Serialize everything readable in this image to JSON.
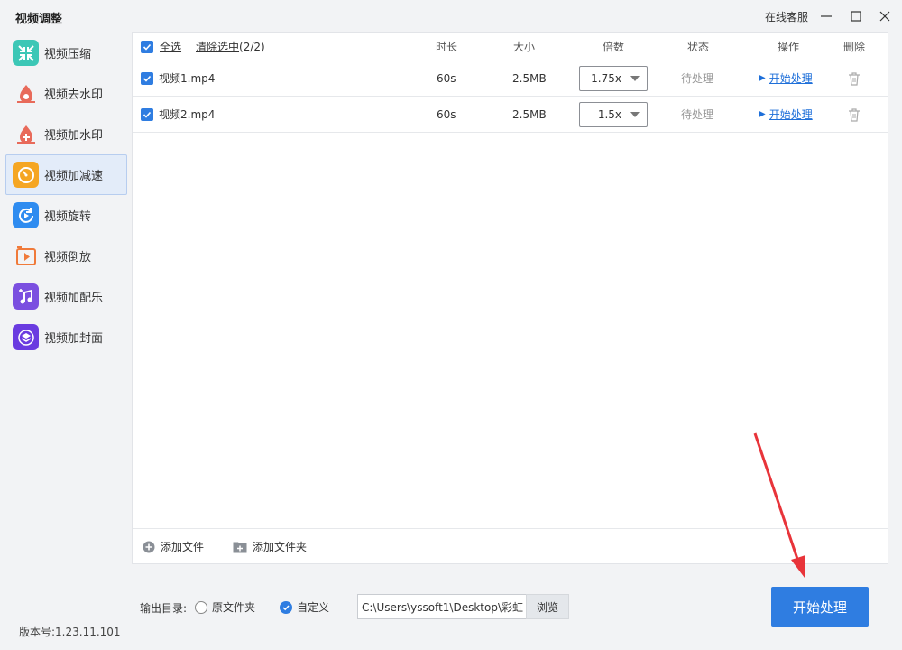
{
  "app": {
    "title": "视频调整",
    "service_label": "在线客服"
  },
  "sidebar": {
    "items": [
      {
        "label": "视频压缩",
        "icon": "compress-icon",
        "color": "#3cc7b6"
      },
      {
        "label": "视频去水印",
        "icon": "watermark-remove-icon",
        "color": "#e86a5a"
      },
      {
        "label": "视频加水印",
        "icon": "watermark-add-icon",
        "color": "#e86a5a"
      },
      {
        "label": "视频加减速",
        "icon": "speed-icon",
        "color": "#f5a623"
      },
      {
        "label": "视频旋转",
        "icon": "rotate-icon",
        "color": "#2f8cf0"
      },
      {
        "label": "视频倒放",
        "icon": "reverse-icon",
        "color": "#f07a3a"
      },
      {
        "label": "视频加配乐",
        "icon": "music-icon",
        "color": "#7b4fe0"
      },
      {
        "label": "视频加封面",
        "icon": "cover-icon",
        "color": "#6a3be0"
      }
    ],
    "active_index": 3
  },
  "table": {
    "select_all": "全选",
    "clear_selected": "清除选中",
    "selected_count": "(2/2)",
    "columns": {
      "duration": "时长",
      "size": "大小",
      "speed": "倍数",
      "status": "状态",
      "action": "操作",
      "delete": "删除"
    },
    "rows": [
      {
        "name": "视频1.mp4",
        "duration": "60s",
        "size": "2.5MB",
        "speed": "1.75x",
        "status": "待处理",
        "action": "开始处理"
      },
      {
        "name": "视频2.mp4",
        "duration": "60s",
        "size": "2.5MB",
        "speed": "1.5x",
        "status": "待处理",
        "action": "开始处理"
      }
    ],
    "add_file": "添加文件",
    "add_folder": "添加文件夹"
  },
  "output": {
    "label": "输出目录:",
    "option_original": "原文件夹",
    "option_custom": "自定义",
    "path": "C:\\Users\\yssoft1\\Desktop\\彩虹",
    "browse": "浏览"
  },
  "start_button": "开始处理",
  "version": "版本号:1.23.11.101",
  "colors": {
    "accent": "#2f7de1",
    "arrow": "#e8343a"
  }
}
